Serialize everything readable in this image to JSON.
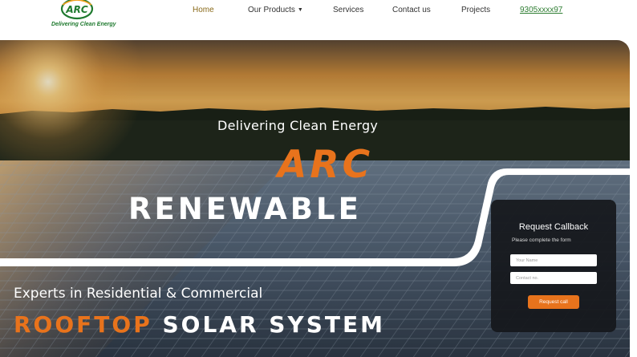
{
  "brand": {
    "logo_text": "ARC",
    "tagline": "Delivering Clean Energy"
  },
  "nav": {
    "items": [
      {
        "label": "Home",
        "active": true
      },
      {
        "label": "Our Products",
        "has_dropdown": true
      },
      {
        "label": "Services"
      },
      {
        "label": "Contact us"
      },
      {
        "label": "Projects"
      }
    ],
    "phone": "9305xxxx97"
  },
  "hero": {
    "subtitle": "Delivering Clean Energy",
    "brand_line1": "ARC",
    "brand_line2": "RENEWABLE",
    "expert_line": "Experts in Residential & Commercial",
    "headline_accent": "ROOFTOP",
    "headline_rest": "SOLAR SYSTEM"
  },
  "callback": {
    "title": "Request Callback",
    "subtitle": "Please complete the form",
    "name_placeholder": "Your Name",
    "contact_placeholder": "Contact no.",
    "button_label": "Request call"
  },
  "colors": {
    "accent_orange": "#e8731c",
    "brand_green": "#2e7d32",
    "active_nav": "#8a6a1a"
  },
  "icons": {
    "dropdown": "chevron-down-icon",
    "logo": "arc-logo-icon"
  }
}
